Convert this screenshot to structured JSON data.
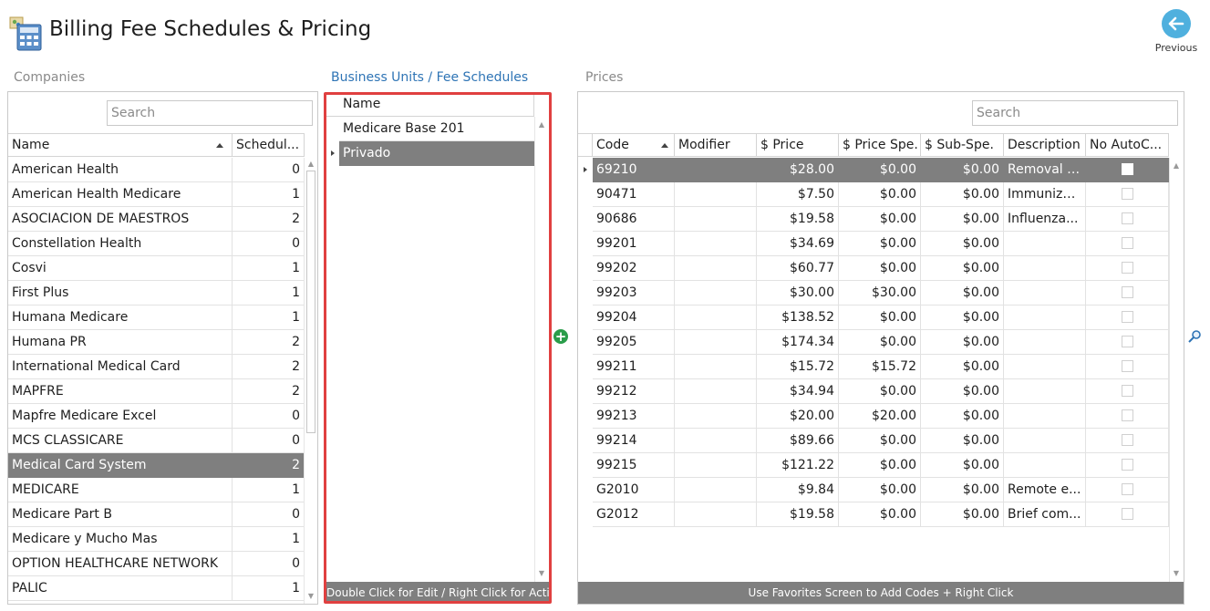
{
  "header": {
    "title": "Billing Fee Schedules & Pricing",
    "previous_label": "Previous",
    "accent_color": "#4fb0de"
  },
  "sections": {
    "companies": "Companies",
    "business_units": "Business Units / Fee Schedules",
    "prices": "Prices"
  },
  "companies": {
    "search_placeholder": "Search",
    "columns": [
      "Name",
      "Schedul..."
    ],
    "rows": [
      {
        "name": "American Health",
        "count": "0"
      },
      {
        "name": "American Health Medicare",
        "count": "1"
      },
      {
        "name": "ASOCIACION DE MAESTROS",
        "count": "2"
      },
      {
        "name": "Constellation Health",
        "count": "0"
      },
      {
        "name": "Cosvi",
        "count": "1"
      },
      {
        "name": "First Plus",
        "count": "1"
      },
      {
        "name": "Humana Medicare",
        "count": "1"
      },
      {
        "name": "Humana PR",
        "count": "2"
      },
      {
        "name": "International Medical Card",
        "count": "2"
      },
      {
        "name": "MAPFRE",
        "count": "2"
      },
      {
        "name": "Mapfre Medicare Excel",
        "count": "0"
      },
      {
        "name": "MCS CLASSICARE",
        "count": "0"
      },
      {
        "name": "Medical Card System",
        "count": "2"
      },
      {
        "name": "MEDICARE",
        "count": "1"
      },
      {
        "name": "Medicare Part B",
        "count": "0"
      },
      {
        "name": "Medicare y Mucho Mas",
        "count": "1"
      },
      {
        "name": "OPTION HEALTHCARE NETWORK",
        "count": "0"
      },
      {
        "name": "PALIC",
        "count": "1"
      }
    ],
    "selected_index": 12
  },
  "fee_schedules": {
    "column": "Name",
    "rows": [
      "Medicare Base 201",
      "Privado"
    ],
    "selected_index": 1,
    "footer": "Double Click for Edit / Right Click for Actions"
  },
  "prices": {
    "search_placeholder": "Search",
    "columns": [
      "Code",
      "Modifier",
      "$ Price",
      "$ Price Spe.",
      "$ Sub-Spe.",
      "Description",
      "No AutoC..."
    ],
    "rows": [
      {
        "code": "69210",
        "modifier": "",
        "price": "$28.00",
        "price_spe": "$0.00",
        "sub_spe": "$0.00",
        "description": "Removal i...",
        "no_auto": false
      },
      {
        "code": "90471",
        "modifier": "",
        "price": "$7.50",
        "price_spe": "$0.00",
        "sub_spe": "$0.00",
        "description": "Immuniza...",
        "no_auto": false
      },
      {
        "code": "90686",
        "modifier": "",
        "price": "$19.58",
        "price_spe": "$0.00",
        "sub_spe": "$0.00",
        "description": "Influenza...",
        "no_auto": false
      },
      {
        "code": "99201",
        "modifier": "",
        "price": "$34.69",
        "price_spe": "$0.00",
        "sub_spe": "$0.00",
        "description": "",
        "no_auto": false
      },
      {
        "code": "99202",
        "modifier": "",
        "price": "$60.77",
        "price_spe": "$0.00",
        "sub_spe": "$0.00",
        "description": "",
        "no_auto": false
      },
      {
        "code": "99203",
        "modifier": "",
        "price": "$30.00",
        "price_spe": "$30.00",
        "sub_spe": "$0.00",
        "description": "",
        "no_auto": false
      },
      {
        "code": "99204",
        "modifier": "",
        "price": "$138.52",
        "price_spe": "$0.00",
        "sub_spe": "$0.00",
        "description": "",
        "no_auto": false
      },
      {
        "code": "99205",
        "modifier": "",
        "price": "$174.34",
        "price_spe": "$0.00",
        "sub_spe": "$0.00",
        "description": "",
        "no_auto": false
      },
      {
        "code": "99211",
        "modifier": "",
        "price": "$15.72",
        "price_spe": "$15.72",
        "sub_spe": "$0.00",
        "description": "",
        "no_auto": false
      },
      {
        "code": "99212",
        "modifier": "",
        "price": "$34.94",
        "price_spe": "$0.00",
        "sub_spe": "$0.00",
        "description": "",
        "no_auto": false
      },
      {
        "code": "99213",
        "modifier": "",
        "price": "$20.00",
        "price_spe": "$20.00",
        "sub_spe": "$0.00",
        "description": "",
        "no_auto": false
      },
      {
        "code": "99214",
        "modifier": "",
        "price": "$89.66",
        "price_spe": "$0.00",
        "sub_spe": "$0.00",
        "description": "",
        "no_auto": false
      },
      {
        "code": "99215",
        "modifier": "",
        "price": "$121.22",
        "price_spe": "$0.00",
        "sub_spe": "$0.00",
        "description": "",
        "no_auto": false
      },
      {
        "code": "G2010",
        "modifier": "",
        "price": "$9.84",
        "price_spe": "$0.00",
        "sub_spe": "$0.00",
        "description": "Remote e...",
        "no_auto": false
      },
      {
        "code": "G2012",
        "modifier": "",
        "price": "$19.58",
        "price_spe": "$0.00",
        "sub_spe": "$0.00",
        "description": "Brief com...",
        "no_auto": false
      }
    ],
    "selected_index": 0,
    "footer": "Use Favorites Screen to Add Codes + Right Click"
  },
  "icons": {
    "app": "billing-calculator-icon",
    "previous": "arrow-left-icon",
    "add": "plus-circle-icon",
    "zoom": "magnifier-icon"
  },
  "colors": {
    "selection": "#7f7f7f",
    "section_active": "#2e74b5",
    "highlight": "#e04040",
    "add_green": "#2a9d4a"
  }
}
